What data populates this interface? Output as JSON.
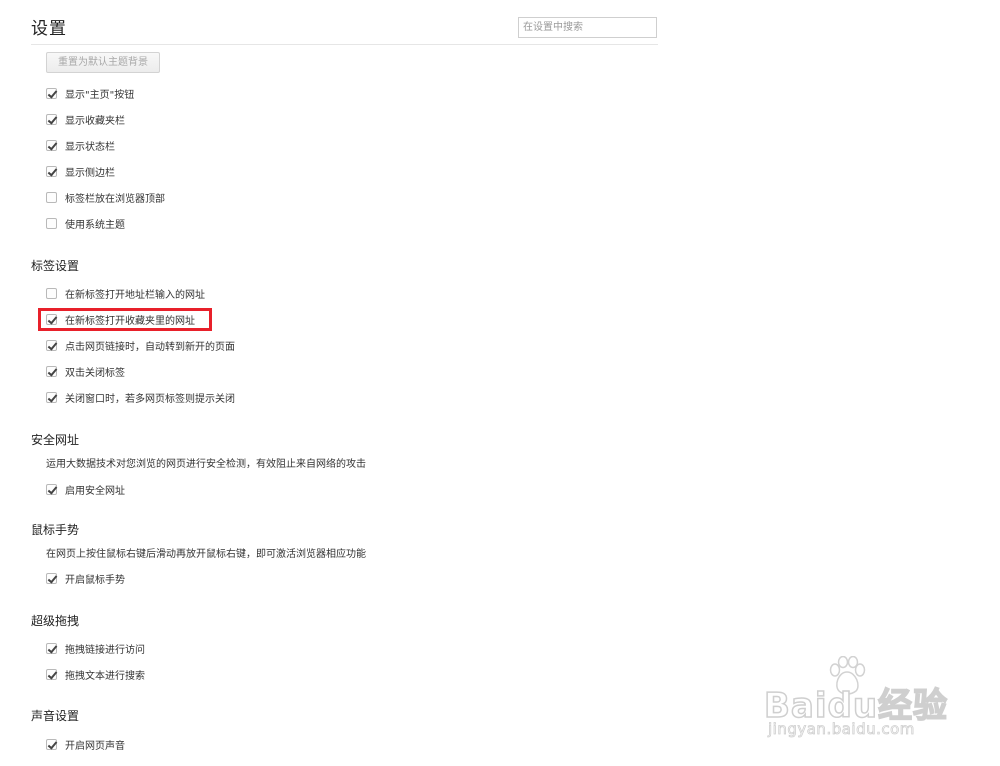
{
  "header": {
    "title": "设置",
    "search_placeholder": "在设置中搜索"
  },
  "appearance": {
    "reset_button_label": "重置为默认主题背景",
    "options": [
      {
        "label": "显示\"主页\"按钮",
        "checked": true
      },
      {
        "label": "显示收藏夹栏",
        "checked": true
      },
      {
        "label": "显示状态栏",
        "checked": true
      },
      {
        "label": "显示侧边栏",
        "checked": true
      },
      {
        "label": "标签栏放在浏览器顶部",
        "checked": false
      },
      {
        "label": "使用系统主题",
        "checked": false
      }
    ]
  },
  "tabs_section": {
    "heading": "标签设置",
    "options": [
      {
        "label": "在新标签打开地址栏输入的网址",
        "checked": false
      },
      {
        "label": "在新标签打开收藏夹里的网址",
        "checked": true,
        "highlighted": true
      },
      {
        "label": "点击网页链接时，自动转到新开的页面",
        "checked": true
      },
      {
        "label": "双击关闭标签",
        "checked": true
      },
      {
        "label": "关闭窗口时，若多网页标签则提示关闭",
        "checked": true
      }
    ]
  },
  "safe_browsing": {
    "heading": "安全网址",
    "description": "运用大数据技术对您浏览的网页进行安全检测，有效阻止来自网络的攻击",
    "options": [
      {
        "label": "启用安全网址",
        "checked": true
      }
    ]
  },
  "mouse_gestures": {
    "heading": "鼠标手势",
    "description": "在网页上按住鼠标右键后滑动再放开鼠标右键，即可激活浏览器相应功能",
    "options": [
      {
        "label": "开启鼠标手势",
        "checked": true
      }
    ]
  },
  "super_drag": {
    "heading": "超级拖拽",
    "options": [
      {
        "label": "拖拽链接进行访问",
        "checked": true
      },
      {
        "label": "拖拽文本进行搜索",
        "checked": true
      }
    ]
  },
  "sound": {
    "heading": "声音设置",
    "options": [
      {
        "label": "开启网页声音",
        "checked": true
      }
    ]
  },
  "watermark": {
    "brand": "Baidu经验",
    "url": "jingyan.baidu.com"
  },
  "colors": {
    "highlight_border": "#e8202a",
    "checkmark": "#444444"
  }
}
